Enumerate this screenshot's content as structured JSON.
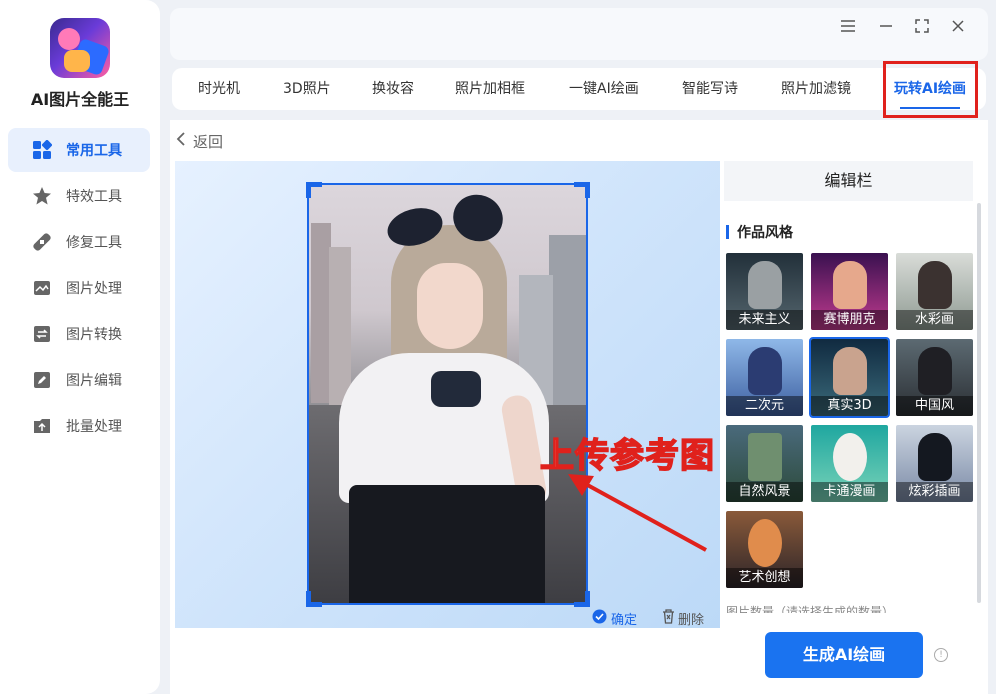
{
  "app": {
    "name": "AI图片全能王"
  },
  "sidebar": {
    "items": [
      {
        "label": "常用工具",
        "icon": "grid-icon",
        "active": true
      },
      {
        "label": "特效工具",
        "icon": "star-icon",
        "active": false
      },
      {
        "label": "修复工具",
        "icon": "bandage-icon",
        "active": false
      },
      {
        "label": "图片处理",
        "icon": "image-icon",
        "active": false
      },
      {
        "label": "图片转换",
        "icon": "convert-icon",
        "active": false
      },
      {
        "label": "图片编辑",
        "icon": "edit-icon",
        "active": false
      },
      {
        "label": "批量处理",
        "icon": "upload-icon",
        "active": false
      }
    ]
  },
  "tabs": [
    {
      "label": "时光机",
      "active": false
    },
    {
      "label": "3D照片",
      "active": false
    },
    {
      "label": "换妆容",
      "active": false
    },
    {
      "label": "照片加相框",
      "active": false
    },
    {
      "label": "一键AI绘画",
      "active": false
    },
    {
      "label": "智能写诗",
      "active": false
    },
    {
      "label": "照片加滤镜",
      "active": false
    },
    {
      "label": "玩转AI绘画",
      "active": true
    }
  ],
  "main": {
    "back_label": "返回",
    "annotation": "上传参考图",
    "confirm_label": "确定",
    "delete_label": "删除"
  },
  "panel": {
    "title": "编辑栏",
    "style_section": "作品风格",
    "styles": [
      {
        "label": "未来主义",
        "selected": false
      },
      {
        "label": "赛博朋克",
        "selected": false
      },
      {
        "label": "水彩画",
        "selected": false
      },
      {
        "label": "二次元",
        "selected": false
      },
      {
        "label": "真实3D",
        "selected": true
      },
      {
        "label": "中国风",
        "selected": false
      },
      {
        "label": "自然风景",
        "selected": false
      },
      {
        "label": "卡通漫画",
        "selected": false
      },
      {
        "label": "炫彩插画",
        "selected": false
      },
      {
        "label": "艺术创想",
        "selected": false
      }
    ],
    "next_section_partial": "图片数量（请选择生成的数量）"
  },
  "generate_label": "生成AI绘画",
  "colors": {
    "accent": "#1a66e8",
    "highlight": "#e0211c",
    "button": "#1a73f0"
  }
}
